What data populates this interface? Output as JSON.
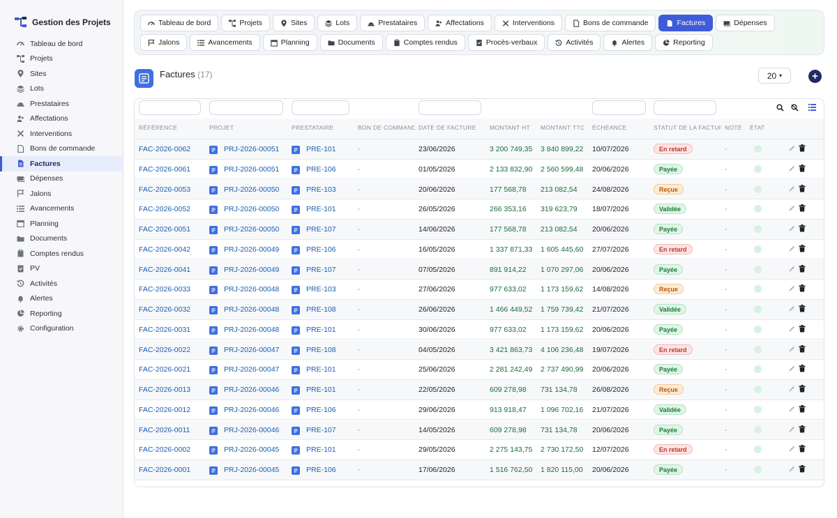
{
  "app": {
    "title": "Gestion des Projets"
  },
  "sidebar": {
    "items": [
      {
        "label": "Tableau de bord",
        "icon": "dashboard-icon"
      },
      {
        "label": "Projets",
        "icon": "sitemap-icon"
      },
      {
        "label": "Sites",
        "icon": "map-pin-icon"
      },
      {
        "label": "Lots",
        "icon": "layers-icon"
      },
      {
        "label": "Prestataires",
        "icon": "hard-hat-icon"
      },
      {
        "label": "Affectations",
        "icon": "users-icon"
      },
      {
        "label": "Interventions",
        "icon": "tools-icon"
      },
      {
        "label": "Bons de commande",
        "icon": "file-icon"
      },
      {
        "label": "Factures",
        "icon": "invoice-icon",
        "active": true
      },
      {
        "label": "Dépenses",
        "icon": "money-icon"
      },
      {
        "label": "Jalons",
        "icon": "flag-icon"
      },
      {
        "label": "Avancements",
        "icon": "list-icon"
      },
      {
        "label": "Planning",
        "icon": "calendar-icon"
      },
      {
        "label": "Documents",
        "icon": "folder-icon"
      },
      {
        "label": "Comptes rendus",
        "icon": "clipboard-icon"
      },
      {
        "label": "PV",
        "icon": "check-file-icon"
      },
      {
        "label": "Activités",
        "icon": "history-icon"
      },
      {
        "label": "Alertes",
        "icon": "bell-icon"
      },
      {
        "label": "Reporting",
        "icon": "pie-chart-icon"
      },
      {
        "label": "Configuration",
        "icon": "gear-icon"
      }
    ]
  },
  "tabs": [
    {
      "label": "Tableau de bord",
      "icon": "dashboard-icon"
    },
    {
      "label": "Projets",
      "icon": "sitemap-icon"
    },
    {
      "label": "Sites",
      "icon": "map-pin-icon"
    },
    {
      "label": "Lots",
      "icon": "layers-icon"
    },
    {
      "label": "Prestataires",
      "icon": "hard-hat-icon"
    },
    {
      "label": "Affectations",
      "icon": "users-icon"
    },
    {
      "label": "Interventions",
      "icon": "tools-icon"
    },
    {
      "label": "Bons de commande",
      "icon": "file-icon"
    },
    {
      "label": "Factures",
      "icon": "invoice-icon",
      "active": true
    },
    {
      "label": "Dépenses",
      "icon": "money-icon"
    },
    {
      "label": "Jalons",
      "icon": "flag-icon"
    },
    {
      "label": "Avancements",
      "icon": "list-icon"
    },
    {
      "label": "Planning",
      "icon": "calendar-icon"
    },
    {
      "label": "Documents",
      "icon": "folder-icon"
    },
    {
      "label": "Comptes rendus",
      "icon": "clipboard-icon"
    },
    {
      "label": "Procès-verbaux",
      "icon": "check-file-icon"
    },
    {
      "label": "Activités",
      "icon": "history-icon"
    },
    {
      "label": "Alertes",
      "icon": "bell-icon"
    },
    {
      "label": "Reporting",
      "icon": "pie-chart-icon"
    }
  ],
  "page": {
    "title": "Factures",
    "count": "(17)",
    "per_page": "20"
  },
  "colors": {
    "accent": "#3f5bd9",
    "money": "#1a6b3c",
    "link": "#1a5fb0"
  },
  "table": {
    "headers": [
      "RÉFÉRENCE",
      "PROJET",
      "PRESTATAIRE",
      "BON DE COMMANDE",
      "DATE DE FACTURE",
      "MONTANT HT",
      "MONTANT TTC",
      "ÉCHÉANCE",
      "STATUT DE LA FACTURE",
      "NOTE",
      "ÉTAT"
    ],
    "rows": [
      {
        "ref": "FAC-2026-0062",
        "projet": "PRJ-2026-00051",
        "prest": "PRE-101",
        "bon": "-",
        "date": "23/06/2026",
        "ht": "3 200 749,35",
        "ttc": "3 840 899,22",
        "ech": "10/07/2026",
        "statut": "En retard",
        "note": "-"
      },
      {
        "ref": "FAC-2026-0061",
        "projet": "PRJ-2026-00051",
        "prest": "PRE-106",
        "bon": "-",
        "date": "01/05/2026",
        "ht": "2 133 832,90",
        "ttc": "2 560 599,48",
        "ech": "20/06/2026",
        "statut": "Payée",
        "note": "-"
      },
      {
        "ref": "FAC-2026-0053",
        "projet": "PRJ-2026-00050",
        "prest": "PRE-103",
        "bon": "-",
        "date": "20/06/2026",
        "ht": "177 568,78",
        "ttc": "213 082,54",
        "ech": "24/08/2026",
        "statut": "Reçue",
        "note": "-"
      },
      {
        "ref": "FAC-2026-0052",
        "projet": "PRJ-2026-00050",
        "prest": "PRE-101",
        "bon": "-",
        "date": "26/05/2026",
        "ht": "266 353,16",
        "ttc": "319 623,79",
        "ech": "18/07/2026",
        "statut": "Validée",
        "note": "-"
      },
      {
        "ref": "FAC-2026-0051",
        "projet": "PRJ-2026-00050",
        "prest": "PRE-107",
        "bon": "-",
        "date": "14/06/2026",
        "ht": "177 568,78",
        "ttc": "213 082,54",
        "ech": "20/06/2026",
        "statut": "Payée",
        "note": "-"
      },
      {
        "ref": "FAC-2026-0042",
        "projet": "PRJ-2026-00049",
        "prest": "PRE-106",
        "bon": "-",
        "date": "16/05/2026",
        "ht": "1 337 871,33",
        "ttc": "1 605 445,60",
        "ech": "27/07/2026",
        "statut": "En retard",
        "note": "-"
      },
      {
        "ref": "FAC-2026-0041",
        "projet": "PRJ-2026-00049",
        "prest": "PRE-107",
        "bon": "-",
        "date": "07/05/2026",
        "ht": "891 914,22",
        "ttc": "1 070 297,06",
        "ech": "20/06/2026",
        "statut": "Payée",
        "note": "-"
      },
      {
        "ref": "FAC-2026-0033",
        "projet": "PRJ-2026-00048",
        "prest": "PRE-103",
        "bon": "-",
        "date": "27/06/2026",
        "ht": "977 633,02",
        "ttc": "1 173 159,62",
        "ech": "14/08/2026",
        "statut": "Reçue",
        "note": "-"
      },
      {
        "ref": "FAC-2026-0032",
        "projet": "PRJ-2026-00048",
        "prest": "PRE-108",
        "bon": "-",
        "date": "26/06/2026",
        "ht": "1 466 449,52",
        "ttc": "1 759 739,42",
        "ech": "21/07/2026",
        "statut": "Validée",
        "note": "-"
      },
      {
        "ref": "FAC-2026-0031",
        "projet": "PRJ-2026-00048",
        "prest": "PRE-101",
        "bon": "-",
        "date": "30/06/2026",
        "ht": "977 633,02",
        "ttc": "1 173 159,62",
        "ech": "20/06/2026",
        "statut": "Payée",
        "note": "-"
      },
      {
        "ref": "FAC-2026-0022",
        "projet": "PRJ-2026-00047",
        "prest": "PRE-108",
        "bon": "-",
        "date": "04/05/2026",
        "ht": "3 421 863,73",
        "ttc": "4 106 236,48",
        "ech": "19/07/2026",
        "statut": "En retard",
        "note": "-"
      },
      {
        "ref": "FAC-2026-0021",
        "projet": "PRJ-2026-00047",
        "prest": "PRE-101",
        "bon": "-",
        "date": "25/06/2026",
        "ht": "2 281 242,49",
        "ttc": "2 737 490,99",
        "ech": "20/06/2026",
        "statut": "Payée",
        "note": "-"
      },
      {
        "ref": "FAC-2026-0013",
        "projet": "PRJ-2026-00046",
        "prest": "PRE-101",
        "bon": "-",
        "date": "22/05/2026",
        "ht": "609 278,98",
        "ttc": "731 134,78",
        "ech": "26/08/2026",
        "statut": "Reçue",
        "note": "-"
      },
      {
        "ref": "FAC-2026-0012",
        "projet": "PRJ-2026-00046",
        "prest": "PRE-106",
        "bon": "-",
        "date": "29/06/2026",
        "ht": "913 918,47",
        "ttc": "1 096 702,16",
        "ech": "21/07/2026",
        "statut": "Validée",
        "note": "-"
      },
      {
        "ref": "FAC-2026-0011",
        "projet": "PRJ-2026-00046",
        "prest": "PRE-107",
        "bon": "-",
        "date": "14/05/2026",
        "ht": "609 278,98",
        "ttc": "731 134,78",
        "ech": "20/06/2026",
        "statut": "Payée",
        "note": "-"
      },
      {
        "ref": "FAC-2026-0002",
        "projet": "PRJ-2026-00045",
        "prest": "PRE-101",
        "bon": "-",
        "date": "29/05/2026",
        "ht": "2 275 143,75",
        "ttc": "2 730 172,50",
        "ech": "12/07/2026",
        "statut": "En retard",
        "note": "-"
      },
      {
        "ref": "FAC-2026-0001",
        "projet": "PRJ-2026-00045",
        "prest": "PRE-106",
        "bon": "-",
        "date": "17/06/2026",
        "ht": "1 516 762,50",
        "ttc": "1 820 115,00",
        "ech": "20/06/2026",
        "statut": "Payée",
        "note": "-"
      }
    ]
  }
}
